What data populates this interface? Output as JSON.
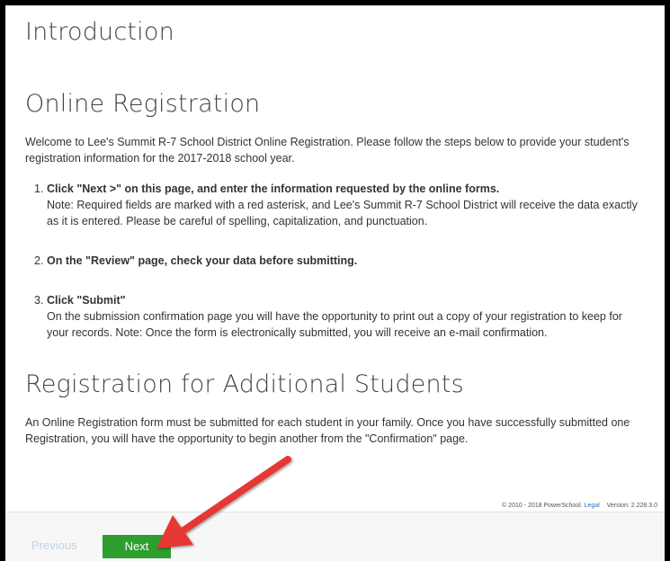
{
  "intro": {
    "heading": "Introduction"
  },
  "registration": {
    "heading": "Online Registration",
    "welcome": "Welcome to Lee's Summit R-7 School District Online Registration. Please follow the steps below to provide your student's registration information for the 2017-2018 school year.",
    "steps": [
      {
        "number": "1.",
        "title": "Click \"Next >\" on this page, and enter the information requested by the online forms.",
        "detail": "Note: Required fields are marked with a red asterisk, and Lee's Summit R-7 School District will receive the data exactly as it is entered. Please be careful of spelling, capitalization, and punctuation."
      },
      {
        "number": "2.",
        "title": "On the \"Review\" page, check your data before submitting.",
        "detail": ""
      },
      {
        "number": "3.",
        "title": "Click \"Submit\"",
        "detail": "On the submission confirmation page you will have the opportunity to print out a copy of your registration to keep for your records. Note: Once the form is electronically submitted, you will receive an e-mail confirmation."
      }
    ]
  },
  "additional": {
    "heading": "Registration for Additional Students",
    "text": "An Online Registration form must be submitted for each student in your family. Once you have successfully submitted one Registration, you will have the opportunity to begin another from the \"Confirmation\" page."
  },
  "footer": {
    "copyright": "© 2010 - 2018 PowerSchool.",
    "legal_link": "Legal",
    "version": "Version: 2.228.3.0"
  },
  "nav": {
    "previous_label": "Previous",
    "next_label": "Next"
  },
  "colors": {
    "next_button": "#2e9e2e",
    "annotation_arrow": "#e53935",
    "frame_border": "#000000"
  }
}
